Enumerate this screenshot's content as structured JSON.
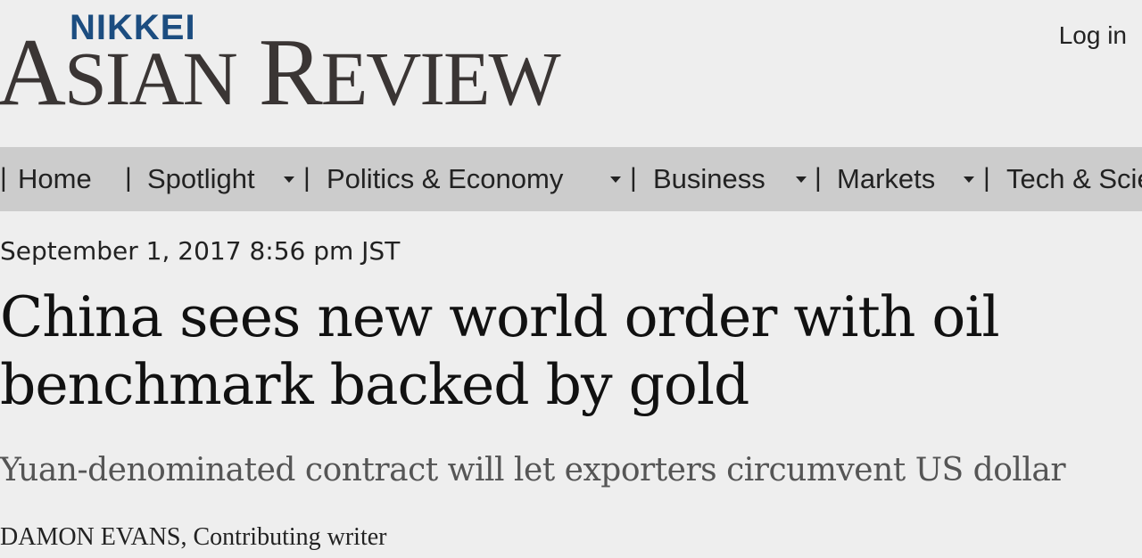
{
  "header": {
    "brand_top": "NIKKEI",
    "brand_main_1_cap": "A",
    "brand_main_1_rest": "SIAN",
    "brand_main_2_cap": "R",
    "brand_main_2_rest": "EVIEW",
    "login_label": "Log in"
  },
  "nav": {
    "items": [
      {
        "label": "Home",
        "has_dropdown": false
      },
      {
        "label": "Spotlight",
        "has_dropdown": true
      },
      {
        "label": "Politics & Economy",
        "has_dropdown": true
      },
      {
        "label": "Business",
        "has_dropdown": true
      },
      {
        "label": "Markets",
        "has_dropdown": true
      },
      {
        "label": "Tech & Science",
        "has_dropdown": false
      }
    ],
    "separator": "|"
  },
  "article": {
    "dateline": "September 1, 2017 8:56 pm JST",
    "headline": "China sees new world order with oil benchmark backed by gold",
    "subheadline": "Yuan-denominated contract will let exporters circumvent US dollar",
    "byline": "DAMON EVANS, Contributing writer"
  },
  "colors": {
    "background": "#eeeeee",
    "navbar": "#cccccc",
    "brand_blue": "#1c4d80",
    "brand_dark": "#3a3534",
    "subhead_gray": "#555555"
  }
}
